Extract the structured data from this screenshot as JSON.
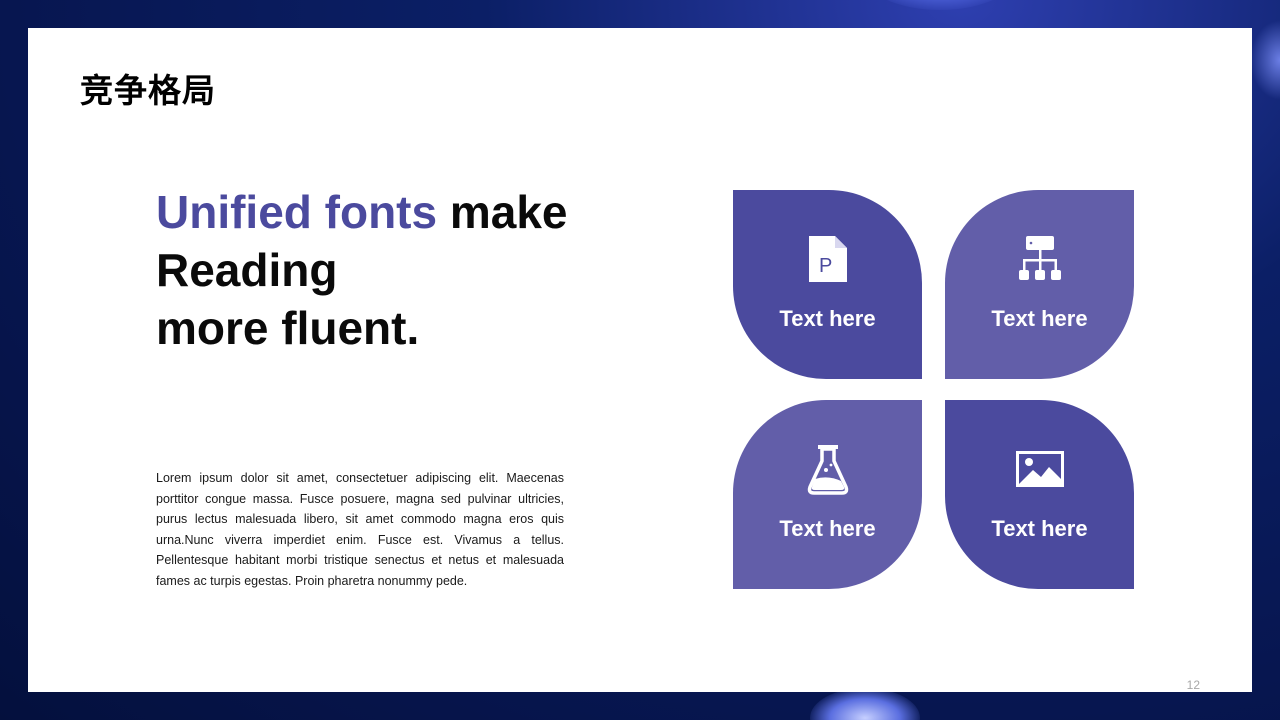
{
  "slide": {
    "section_title": "竞争格局",
    "headline": {
      "accent": "Unified fonts",
      "line1_rest": " make",
      "line2": "Reading",
      "line3": "more fluent."
    },
    "body": "Lorem ipsum dolor sit amet, consectetuer adipiscing elit. Maecenas porttitor congue massa. Fusce posuere, magna sed pulvinar ultricies, purus lectus malesuada libero, sit amet commodo magna eros quis urna.Nunc viverra imperdiet enim. Fusce est. Vivamus a tellus. Pellentesque habitant morbi tristique senectus et netus et malesuada fames ac turpis egestas. Proin pharetra nonummy pede.",
    "page_number": "12"
  },
  "petals": [
    {
      "label": "Text here",
      "icon": "document-p-icon",
      "color": "#4b4a9e"
    },
    {
      "label": "Text here",
      "icon": "hierarchy-icon",
      "color": "#625ea9"
    },
    {
      "label": "Text here",
      "icon": "flask-icon",
      "color": "#625ea9"
    },
    {
      "label": "Text here",
      "icon": "image-icon",
      "color": "#4b4a9e"
    }
  ],
  "colors": {
    "accent": "#4b4a9e",
    "accent_light": "#625ea9",
    "background": "#0b1f66"
  }
}
